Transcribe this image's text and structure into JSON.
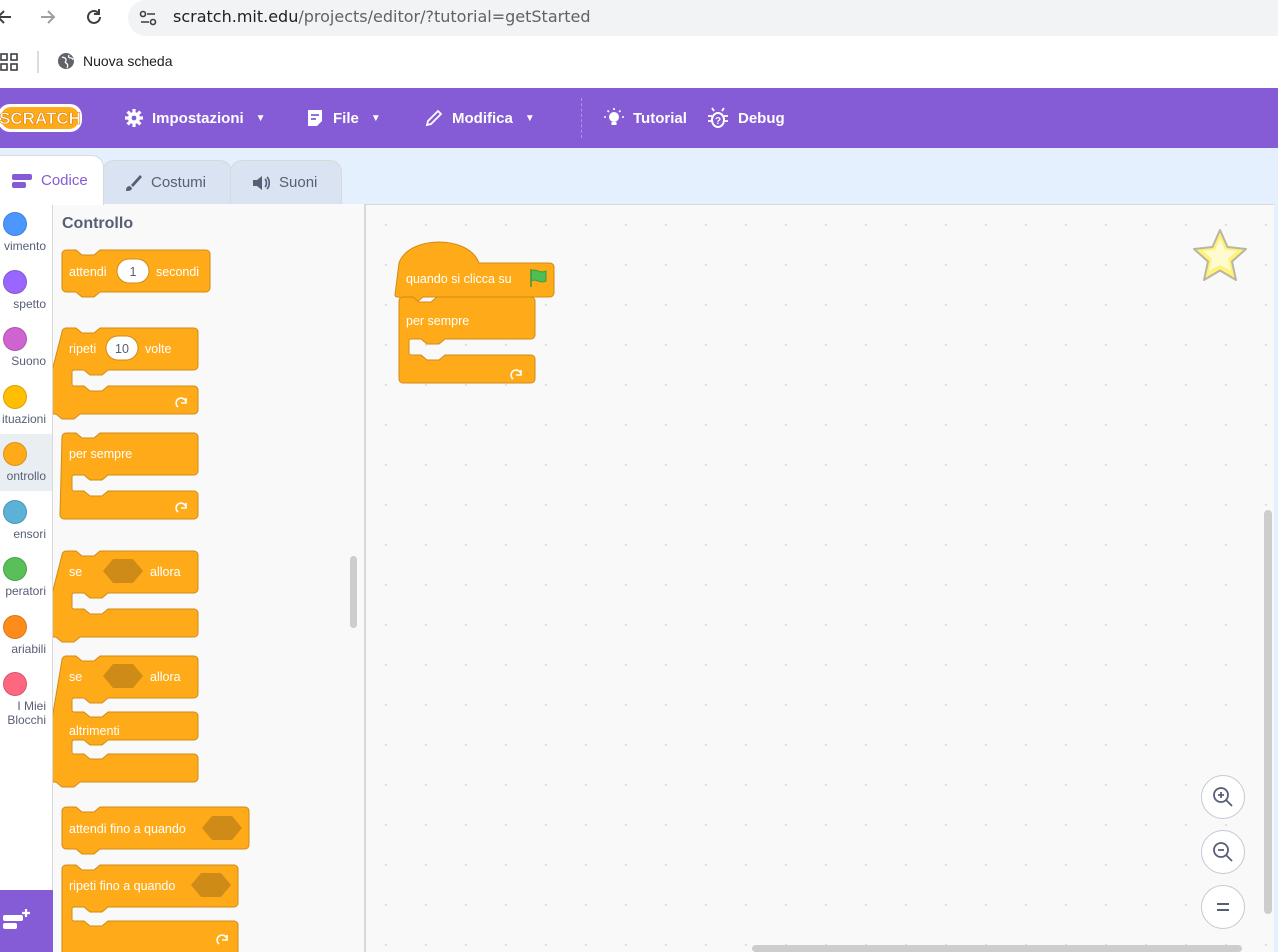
{
  "browser": {
    "url_host": "scratch.mit.edu",
    "url_path": "/projects/editor/?tutorial=getStarted",
    "bookmark_label": "Nuova scheda"
  },
  "menubar": {
    "logo_text": "SCRATCH",
    "settings_label": "Impostazioni",
    "file_label": "File",
    "edit_label": "Modifica",
    "tutorials_label": "Tutorial",
    "debug_label": "Debug"
  },
  "tabs": {
    "code": "Codice",
    "costumes": "Costumi",
    "sounds": "Suoni"
  },
  "categories": [
    {
      "label": "vimento",
      "color": "#4c97ff"
    },
    {
      "label": "spetto",
      "color": "#9966ff"
    },
    {
      "label": "Suono",
      "color": "#cf63cf"
    },
    {
      "label": "ituazioni",
      "color": "#ffbf00"
    },
    {
      "label": "ontrollo",
      "color": "#ffab19"
    },
    {
      "label": "ensori",
      "color": "#5cb1d6"
    },
    {
      "label": "peratori",
      "color": "#59c059"
    },
    {
      "label": "ariabili",
      "color": "#ff8c1a"
    },
    {
      "label": "I Miei\nBlocchi",
      "color": "#ff6680"
    }
  ],
  "palette": {
    "title": "Controllo",
    "wait": {
      "label": "attendi",
      "value": "1",
      "suffix": "secondi"
    },
    "repeat": {
      "label": "ripeti",
      "value": "10",
      "suffix": "volte"
    },
    "forever": {
      "label": "per sempre"
    },
    "if_then": {
      "label": "se",
      "suffix": "allora"
    },
    "if_else": {
      "label": "se",
      "suffix": "allora",
      "else_label": "altrimenti"
    },
    "wait_until": {
      "label": "attendi fino a quando"
    },
    "repeat_until": {
      "label": "ripeti fino a quando"
    }
  },
  "workspace": {
    "hat_label": "quando si clicca su",
    "forever_label": "per sempre"
  },
  "colors": {
    "control": "#ffab19",
    "control_border": "#cf8b17",
    "menubar": "#855cd6"
  }
}
